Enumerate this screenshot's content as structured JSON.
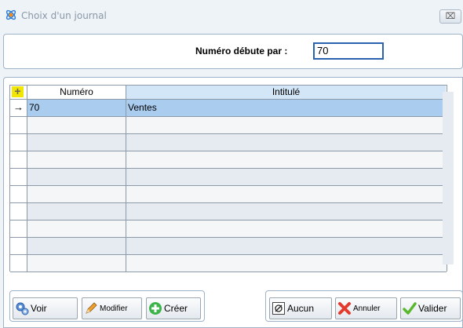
{
  "window": {
    "title": "Choix d'un journal",
    "close_label": "⌧"
  },
  "filter": {
    "label": "Numéro débute par :",
    "value": "70"
  },
  "grid": {
    "columns": [
      "Numéro",
      "Intitulé"
    ],
    "rows": [
      {
        "indicator": "→",
        "numero": "70",
        "intitule": "Ventes",
        "selected": true
      }
    ],
    "empty_rows": 9
  },
  "buttons": {
    "voir": "Voir",
    "modifier": "Modifier",
    "creer": "Créer",
    "aucun": "Aucun",
    "annuler": "Annuler",
    "valider": "Valider"
  },
  "colors": {
    "selected_row": "#a9ccef",
    "header_highlight": "#d3e6f7",
    "input_border": "#2b62b0"
  }
}
